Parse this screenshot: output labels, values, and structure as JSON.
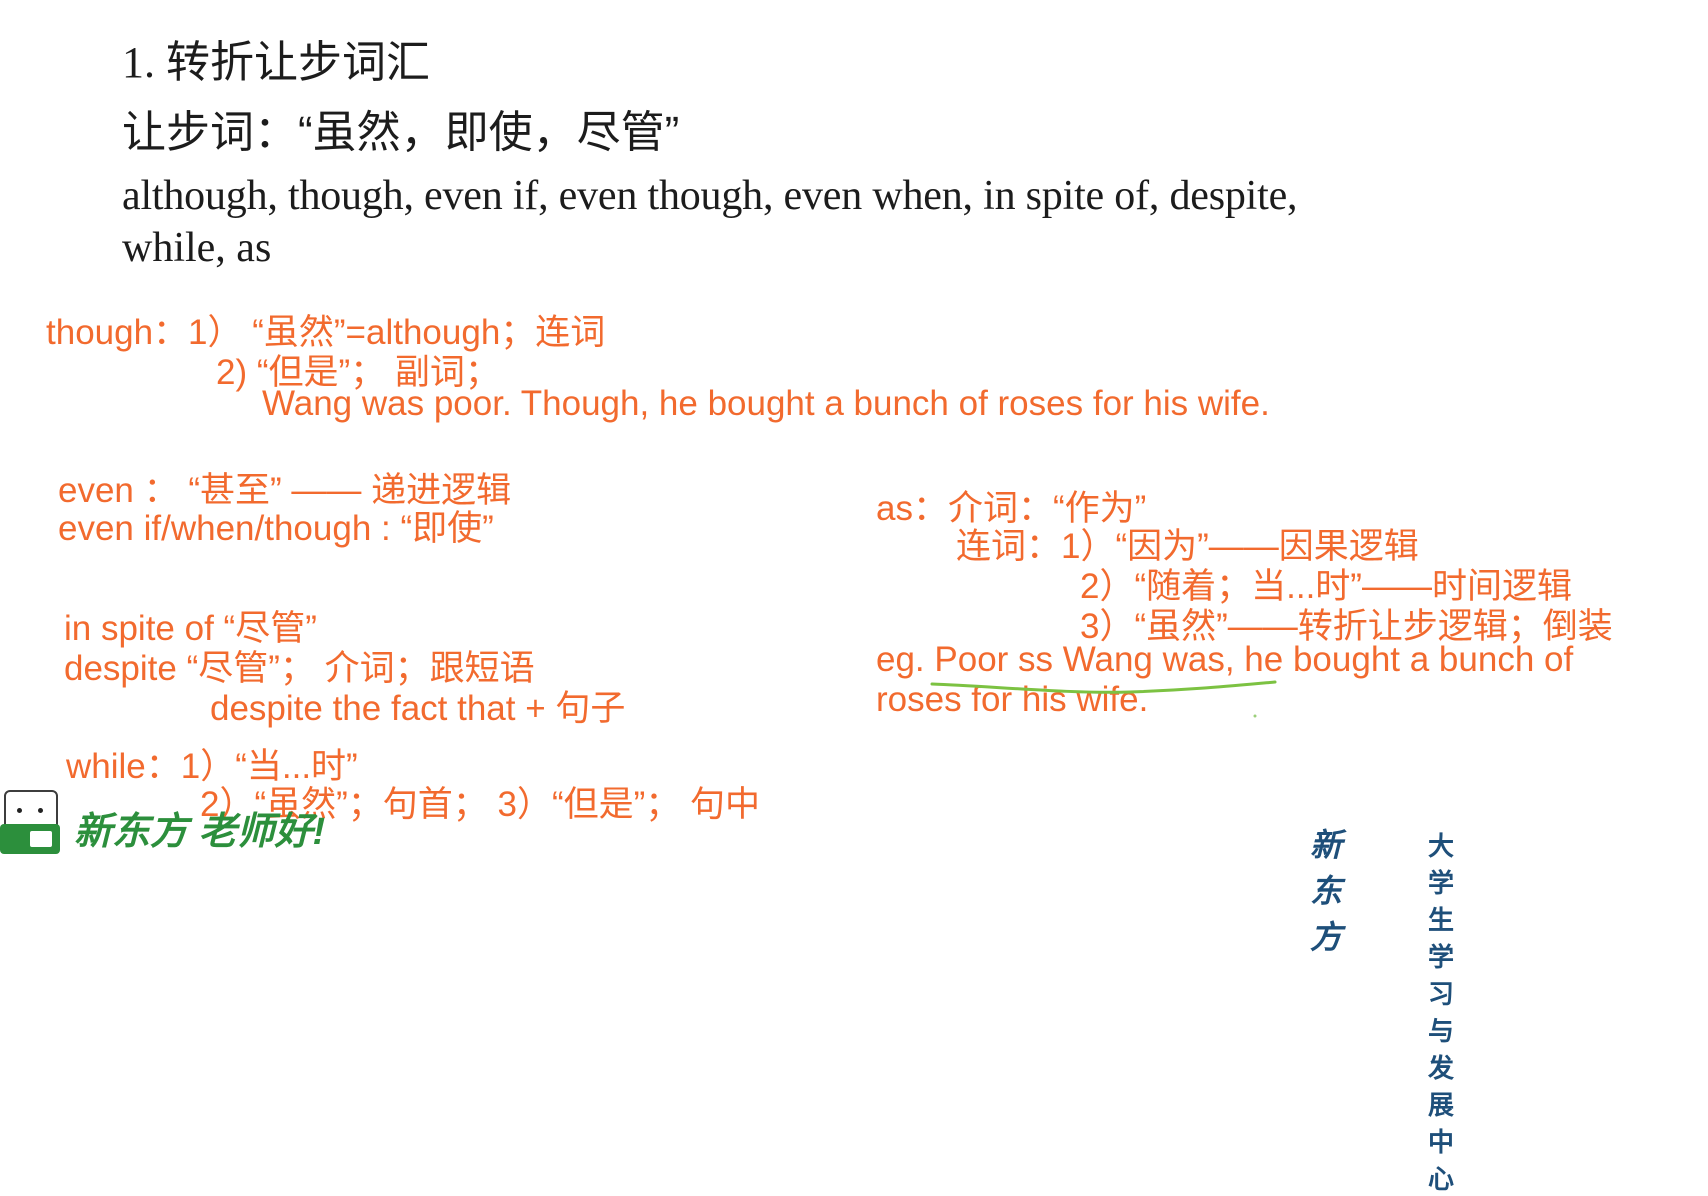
{
  "heading": {
    "title": "1. 转折让步词汇",
    "subtitle": "让步词：“虽然，即使，尽管”",
    "words_line1": "although, though, even if, even though, even when, in spite of, despite,",
    "words_line2": "while, as"
  },
  "though_note": {
    "line1": "though：1） “虽然”=although；连词",
    "line2": "2) “但是”； 副词；",
    "line3": "Wang was poor. Though, he bought a bunch of roses for his wife."
  },
  "even_note": {
    "line1": "even ： “甚至” —— 递进逻辑",
    "line2": "even if/when/though : “即使”"
  },
  "spite_note": {
    "line1": "in spite of “尽管”",
    "line2": "despite “尽管”； 介词；跟短语",
    "line3": "despite the fact that + 句子"
  },
  "while_note": {
    "line1": "while：1）“当...时”",
    "line2": "2）“虽然”；句首；    3）“但是”； 句中"
  },
  "as_note": {
    "line1": "as：介词：“作为”",
    "line2": "连词：1）“因为”——因果逻辑",
    "line3": "2）“随着；当...时”——时间逻辑",
    "line4": "3）“虽然”——转折让步逻辑；倒装",
    "eg_line1": "eg. Poor ss Wang was, he bought a bunch of",
    "eg_line2": "roses for his wife."
  },
  "footer": {
    "left_logo_text": "新东方 老师好!",
    "right_brand": "新东方",
    "right_sub": "大学生学习与发展中心"
  },
  "colors": {
    "text_black": "#1c1c1c",
    "note_orange": "#f26a2e",
    "underline_green": "#7cc242",
    "logo_green": "#2c8f3c",
    "logo_blue": "#1e4f7a"
  }
}
